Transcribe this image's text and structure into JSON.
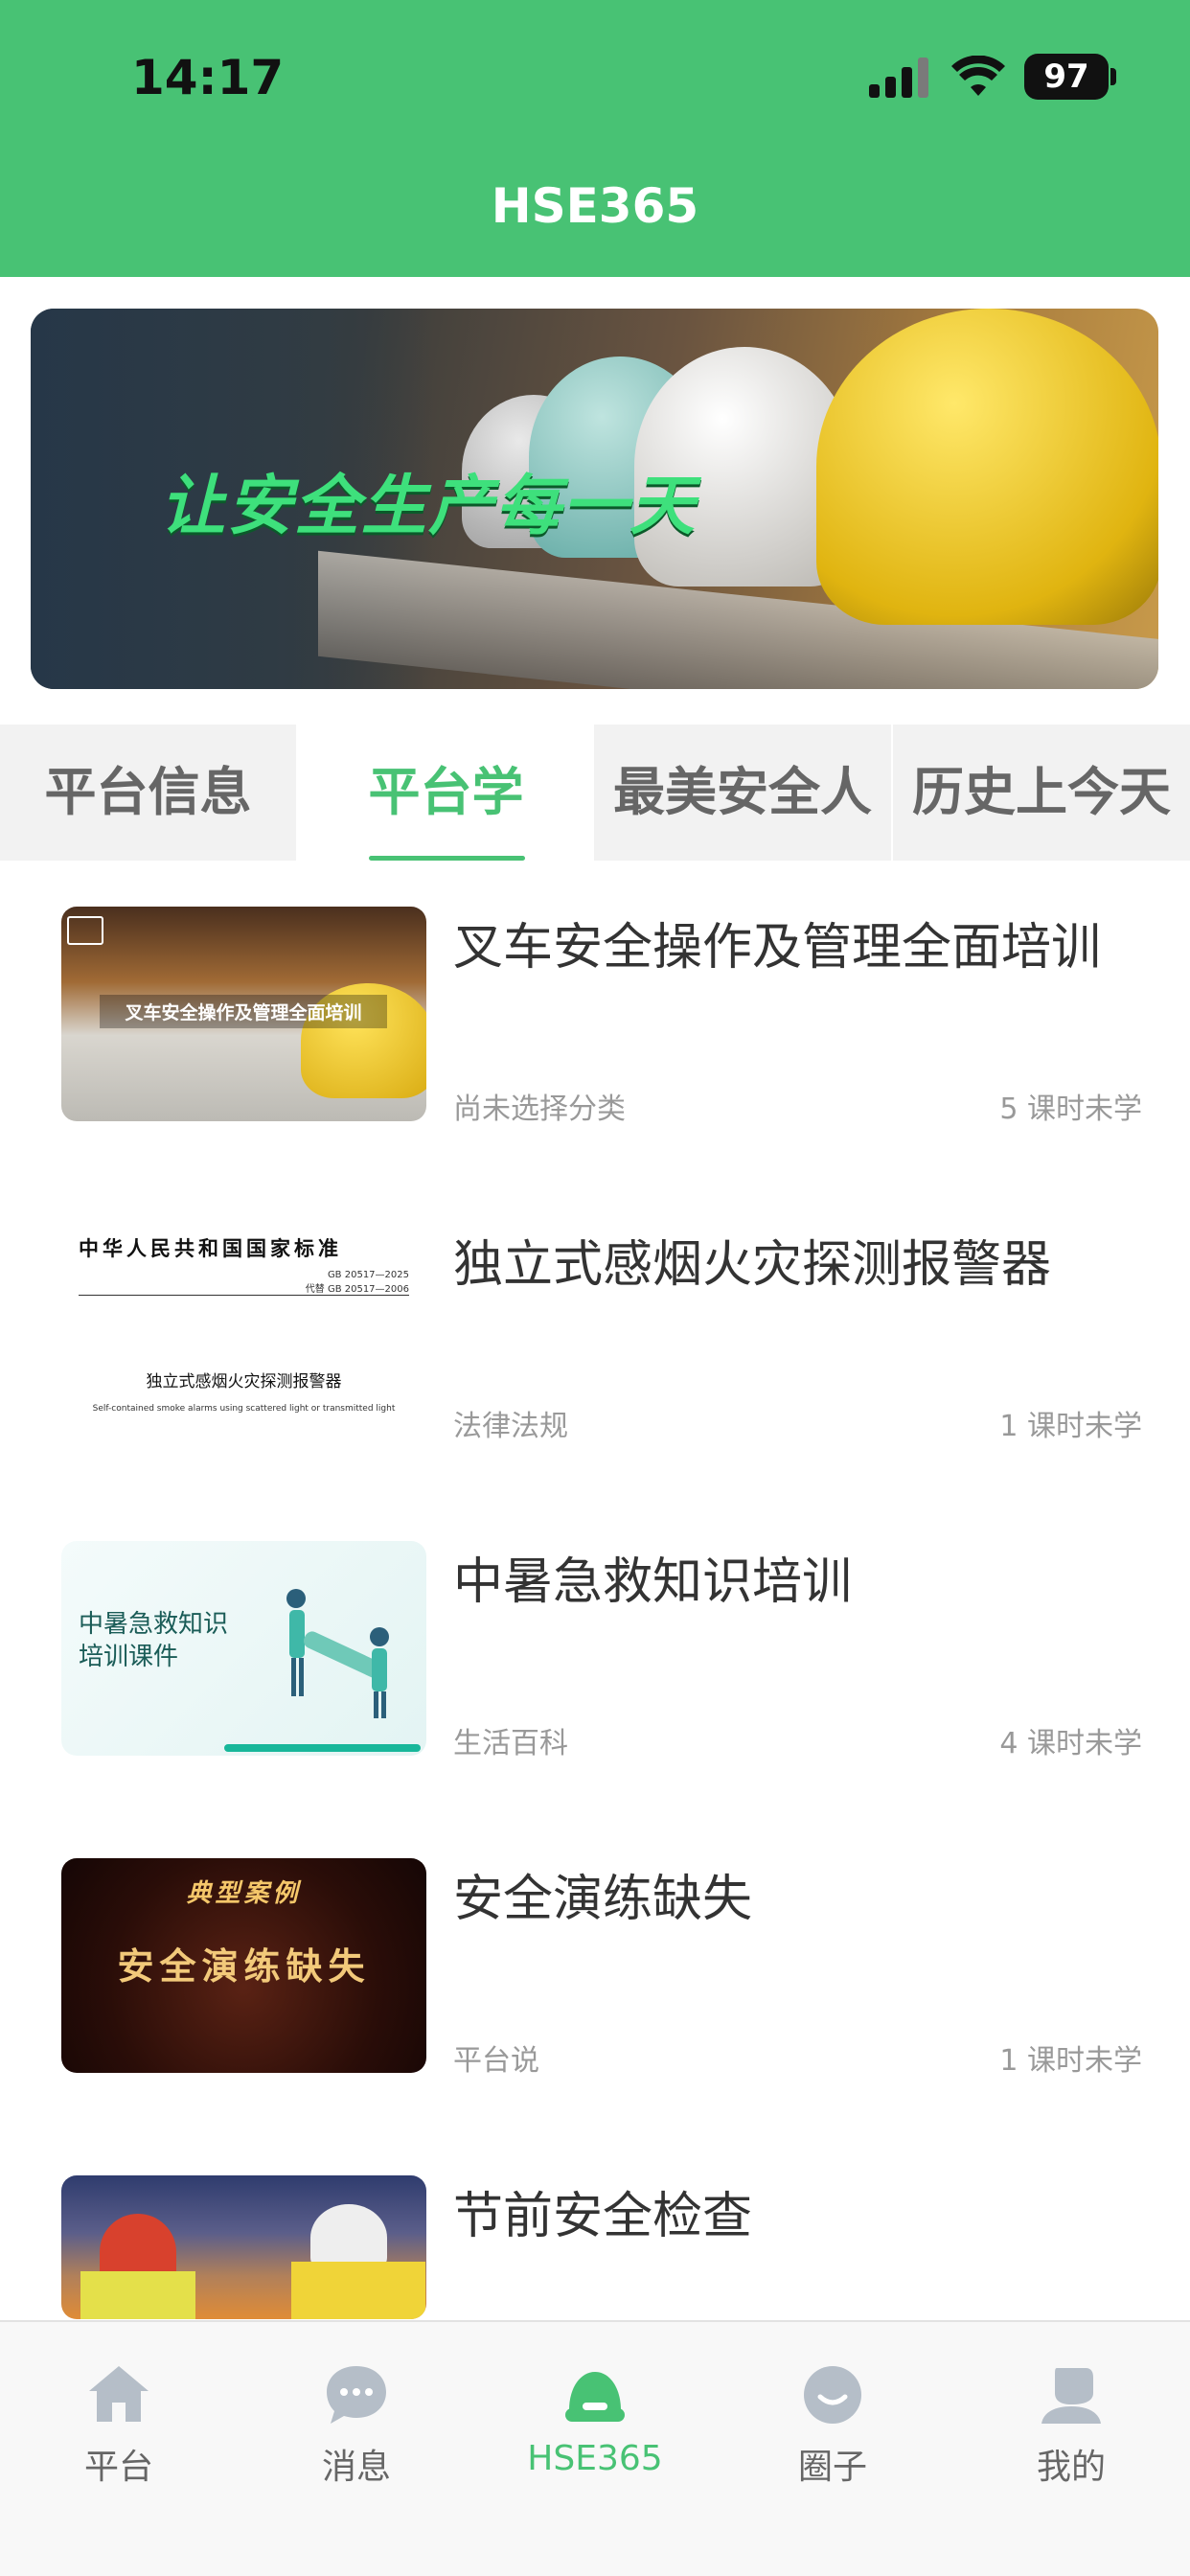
{
  "status_bar": {
    "time": "14:17",
    "battery": "97"
  },
  "header": {
    "title": "HSE365"
  },
  "banner": {
    "slogan": "让安全生产每一天"
  },
  "tabs": [
    {
      "label": "平台信息",
      "active": false
    },
    {
      "label": "平台学",
      "active": true
    },
    {
      "label": "最美安全人",
      "active": false
    },
    {
      "label": "历史上今天",
      "active": false
    }
  ],
  "courses": [
    {
      "title": "叉车安全操作及管理全面培训",
      "category": "尚未选择分类",
      "lessons": "5 课时未学",
      "thumb_caption": "叉车安全操作及管理全面培训"
    },
    {
      "title": "独立式感烟火灾探测报警器",
      "category": "法律法规",
      "lessons": "1 课时未学",
      "thumb_header": "中华人民共和国国家标准",
      "thumb_standard": "GB 20517—2025",
      "thumb_replaces": "代替 GB 20517—2006",
      "thumb_name": "独立式感烟火灾探测报警器",
      "thumb_en": "Self-contained smoke alarms using scattered light or transmitted light"
    },
    {
      "title": "中暑急救知识培训",
      "category": "生活百科",
      "lessons": "4 课时未学",
      "thumb_line1": "中暑急救知识",
      "thumb_line2": "培训课件"
    },
    {
      "title": "安全演练缺失",
      "category": "平台说",
      "lessons": "1 课时未学",
      "thumb_line1": "典型案例",
      "thumb_line2": "安全演练缺失"
    },
    {
      "title": "节前安全检查",
      "category": "",
      "lessons": ""
    }
  ],
  "bottom_nav": [
    {
      "label": "平台",
      "icon": "home-icon",
      "active": false
    },
    {
      "label": "消息",
      "icon": "chat-bubble-icon",
      "active": false
    },
    {
      "label": "HSE365",
      "icon": "helmet-icon",
      "active": true
    },
    {
      "label": "圈子",
      "icon": "smiley-icon",
      "active": false
    },
    {
      "label": "我的",
      "icon": "person-icon",
      "active": false
    }
  ],
  "colors": {
    "brand_green": "#48C274",
    "muted_text": "#999999",
    "tab_bg": "#F2F2F2"
  }
}
